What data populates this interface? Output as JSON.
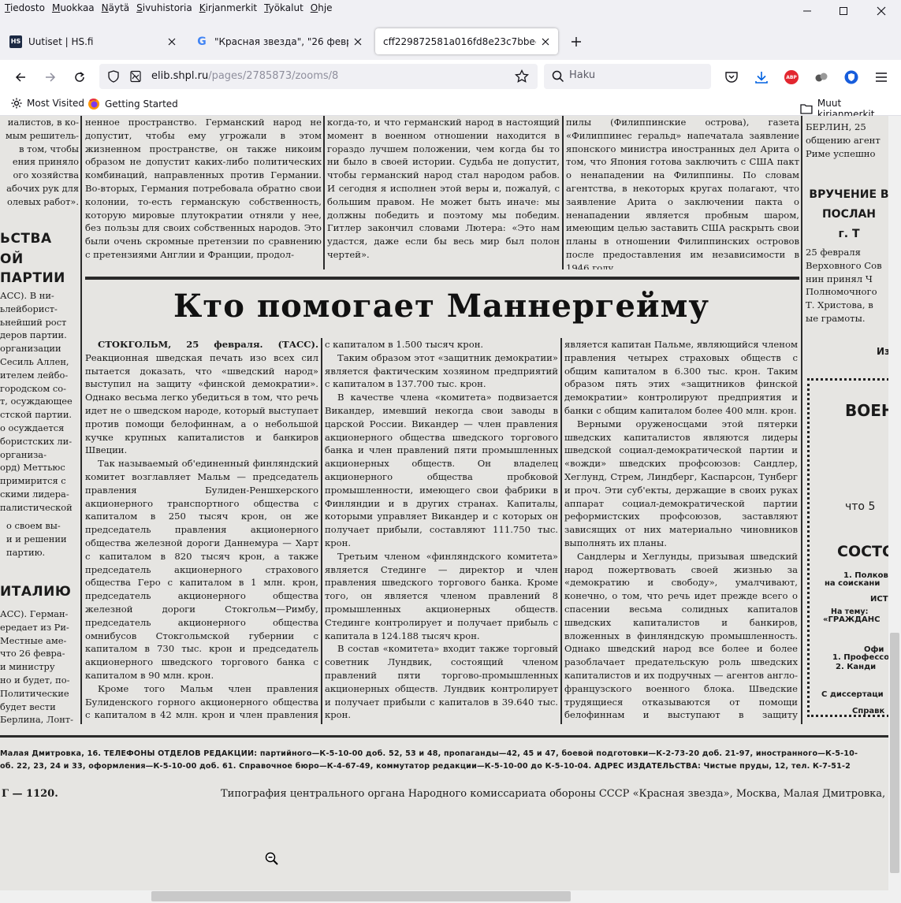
{
  "menu": [
    "Tiedosto",
    "Muokkaa",
    "Näytä",
    "Sivuhistoria",
    "Kirjanmerkit",
    "Työkalut",
    "Ohje"
  ],
  "tabs": [
    {
      "title": "Uutiset | HS.fi",
      "favicon": "HS"
    },
    {
      "title": "\"Красная звезда\", \"26 февраля 19",
      "favicon": "G"
    },
    {
      "title": "cff229872581a016fd8e23c7bbeda2c6b",
      "favicon": ""
    }
  ],
  "url": {
    "host": "elib.shpl.ru",
    "path": "/pages/2785873/zooms/8"
  },
  "search": {
    "placeholder": "Haku"
  },
  "bookmarks": {
    "most_visited": "Most Visited",
    "getting_started": "Getting Started",
    "other": "Muut kirjanmerkit"
  },
  "extensions": {
    "abp": "ABP"
  },
  "colors": {
    "accent_blue": "#0061e0",
    "abp_red": "#e2262f",
    "bitwarden_blue": "#175ddc"
  },
  "newspaper": {
    "headline": "Кто помогает Маннергейму",
    "left_heads": [
      "ЬСТВА",
      "ОЙ",
      "ПАРТИИ",
      "ИТАЛИЮ"
    ],
    "left_top": "иалистов, в ко-\nмым решитель-\nв том, чтобы\nения приняло\nого хозяйства\nабочих рук для\nолевых работ».",
    "left_mid": "АСС). В ни-\nьлейборист-\nьнейший рост\nдеров партии.\nорганизации\nСесиль Аллен,\nителем лейбо-\nгородском со-\nт, осуждающее\nстской партии.\nо осуждается\nбористских ли-\nорганиза-\nорд) Меттьюс\nпримирится с\nскими лидера-\nпалистической",
    "left_mid2": "о своем вы-\nи и решении\nпартию.",
    "left_bottom": "АСС). Герман-\nередает из Ри-\nМестные аме-\nчто 26 февра-\nи министру\nно и будет, по-\nПолитические\nбудет вести\nБерлина, Лонт-",
    "top_col1": "ненное пространство. Германский народ не допустит, чтобы ему угрожали в этом жизненном пространстве, он также никоим образом не допустит каких-либо политических комбинаций, направленных против Германии. Во-вторых, Германия потребовала обратно свои колонии, то-есть германскую собственность, которую мировые плутократии отняли у нее, без пользы для своих собственных народов. Это были очень скромные претензии по сравнению с претензиями Англии и Франции, продол-",
    "top_col2": "когда-то, и что германский народ в настоящий момент в военном отношении находится в гораздо лучшем положении, чем когда бы то ни было в своей истории. Судьба не допустит, чтобы германский народ стал народом рабов. И сегодня я исполнен этой веры и, пожалуй, с большим правом. Не может быть иначе: мы должны победить и поэтому мы победим. Гитлер закончил словами Лютера: «Это нам удастся, даже если бы весь мир был полон чертей».",
    "top_col3": "пилы (Филиппинские острова), газета «Филиппинес геральд» напечатала заявление японского министра иностранных дел Арита о том, что Япония готова заключить с США пакт о ненападении на Филиппины. По словам агентства, в некоторых кругах полагают, что заявление Арита о заключении пакта о ненападении является пробным шаром, имеющим целью заставить США раскрыть свои планы в отношении Филиппинских островов после предоставления им независимости в 1946 году.",
    "right_top": "БЕРЛИН, 25\nобщению агент\nРиме успешно",
    "right_head": "ВРУЧЕНИЕ В\nПОСЛАН\nг. Т",
    "right_mid": "25 февраля\nВерховного Сов\nнин принял Ч\nПолномочного\nТ. Христова, в\nые грамоты.",
    "right_iz": "Из",
    "box": {
      "head": "ВОЕН",
      "line1": "что 5",
      "head2": "СОСТО",
      "l1": "1. Полково",
      "l2": "на соискани",
      "l3": "ИСТ",
      "l4": "На тему:",
      "l5": "«ГРАЖДАНС",
      "l6": "Офи",
      "l7": "1. Профессо",
      "l8": "2. Канди",
      "l9": "С диссертаци",
      "l10": "Справк"
    },
    "body_col1": [
      "СТОКГОЛЬМ, 25 февраля. (ТАСС). Реакционная шведская печать изо всех сил пытается доказать, что «шведский народ» выступил на защиту «финской демократии». Однако весьма легко убедиться в том, что речь идет не о шведском народе, который выступает против помощи белофиннам, а о небольшой кучке крупных капиталистов и банкиров Швеции.",
      "Так называемый об'единенный финляндский комитет возглавляет Мальм — председатель правления Булиден-Реншхерского акционерного транспортного общества с капиталом в 250 тысяч крон, он же председатель правления акционерного общества железной дороги Даннемура — Харт с капиталом в 820 тысяч крон, а также председатель акционерного страхового общества Геро с капиталом в 1 млн. крон, председатель акционерного общества железной дороги Стокгольм—Римбу, председатель акционерного общества омнибусов Стокгольмской губернии с капиталом в 730 тыс. крон и председатель акционерного шведского торгового банка с капиталом в 90 млн. крон.",
      "Кроме того Мальм член правления Булиденского горного акционерного общества с капиталом в 42 млн. крон и член правления акционерного общества гидроэлектрического строительства в Эстерсунде"
    ],
    "body_col2": [
      "с капиталом в 1.500 тысяч крон.",
      "Таким образом этот «защитник демократии» является фактическим хозяином предприятий с капиталом в 137.700 тыс. крон.",
      "В качестве члена «комитета» подвизается Викандер, имевший некогда свои заводы в царской России. Викандер — член правления акционерного общества шведского торгового банка и член правлений пяти промышленных акционерных обществ. Он владелец акционерного общества пробковой промышленности, имеющего свои фабрики в Финляндии и в других странах. Капиталы, которыми управляет Викандер и с которых он получает прибыли, составляют 111.750 тыс. крон.",
      "Третьим членом «финляндского комитета» является Стединге — директор и член правления шведского торгового банка. Кроме того, он является членом правлений 8 промышленных акционерных обществ. Стединге контролирует и получает прибыль с капитала в 124.188 тысяч крон.",
      "В состав «комитета» входит также торговый советник Лундвик, состоящий членом правлений пяти торгово-промышленных акционерных обществ. Лундвик контролирует и получает прибыли с капиталов в 39.640 тыс. крон.",
      "Пятым членом «финляндского комитета»"
    ],
    "body_col3": [
      "является капитан Пальме, являющийся членом правления четырех страховых обществ с общим капиталом в 6.300 тыс. крон. Таким образом пять этих «защитников финской демократии» контролируют предприятия и банки с общим капиталом более 400 млн. крон.",
      "Верными оруженосцами этой пятерки шведских капиталистов являются лидеры шведской социал-демократической партии и «вожди» шведских профсоюзов: Сандлер, Хеглунд, Стрем, Линдберг, Каспарсон, Тунберг и проч. Эти суб'екты, держащие в своих руках аппарат социал-демократической партии реформистских профсоюзов, заставляют зависящих от них материально чиновников выполнять их планы.",
      "Сандлеры и Хеглунды, призывая шведский народ пожертвовать своей жизнью за «демократию и свободу», умалчивают, конечно, о том, что речь идет прежде всего о спасении весьма солидных капиталов шведских капиталистов и банкиров, вложенных в финляндскую промышленность. Однако шведский народ все более и более разоблачает предательскую роль шведских капиталистов и их подручных — агентов англо-французского военного блока. Шведские трудящиеся отказываются от помощи белофиннам и выступают в защиту нейтралитета Швеции."
    ],
    "footer1": "Малая Дмитровка, 16. ТЕЛЕФОНЫ ОТДЕЛОВ РЕДАКЦИИ: партийного—К-5-10-00 доб. 52, 53 и 48, пропаганды—42, 45 и 47, боевой подготовки—К-2-73-20 доб. 21-97, иностранного—К-5-10-",
    "footer2": "об. 22, 23, 24 и 33, оформления—К-5-10-00 доб. 61. Справочное бюро—К-4-67-49, коммутатор редакции—К-5-10-00 до К-5-10-04. АДРЕС ИЗДАТЕЛЬСТВА: Чистые пруды, 12, тел. К-7-51-2",
    "order": "Г — 1120.",
    "imprint": "Типография центрального органа Народного комиссариата обороны СССР «Красная звезда», Москва, Малая Дмитровка,"
  }
}
